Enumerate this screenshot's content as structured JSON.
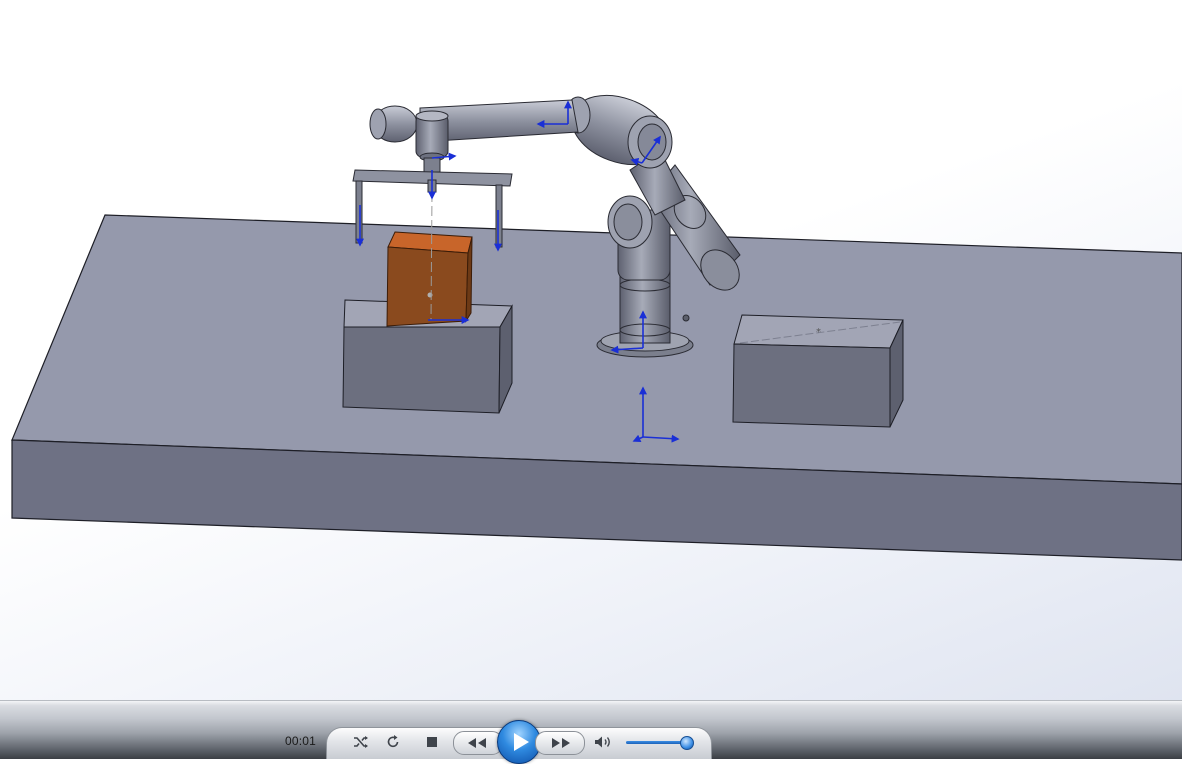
{
  "scene": {
    "description_label": "",
    "colors": {
      "platform_top": "#9599ac",
      "platform_front": "#707386",
      "box_top": "#a3a6b6",
      "box_front": "#6a6d7d",
      "workpiece": "#8a4a1e",
      "robot": "#8e92a0",
      "triad": "#1a2fd6"
    }
  },
  "player": {
    "time": "00:01",
    "volume": 0.95,
    "icons": {
      "shuffle": "shuffle-icon",
      "repeat": "repeat-icon",
      "stop": "stop-icon",
      "previous": "previous-icon",
      "play": "play-icon",
      "next": "next-icon",
      "volume": "volume-icon"
    }
  }
}
